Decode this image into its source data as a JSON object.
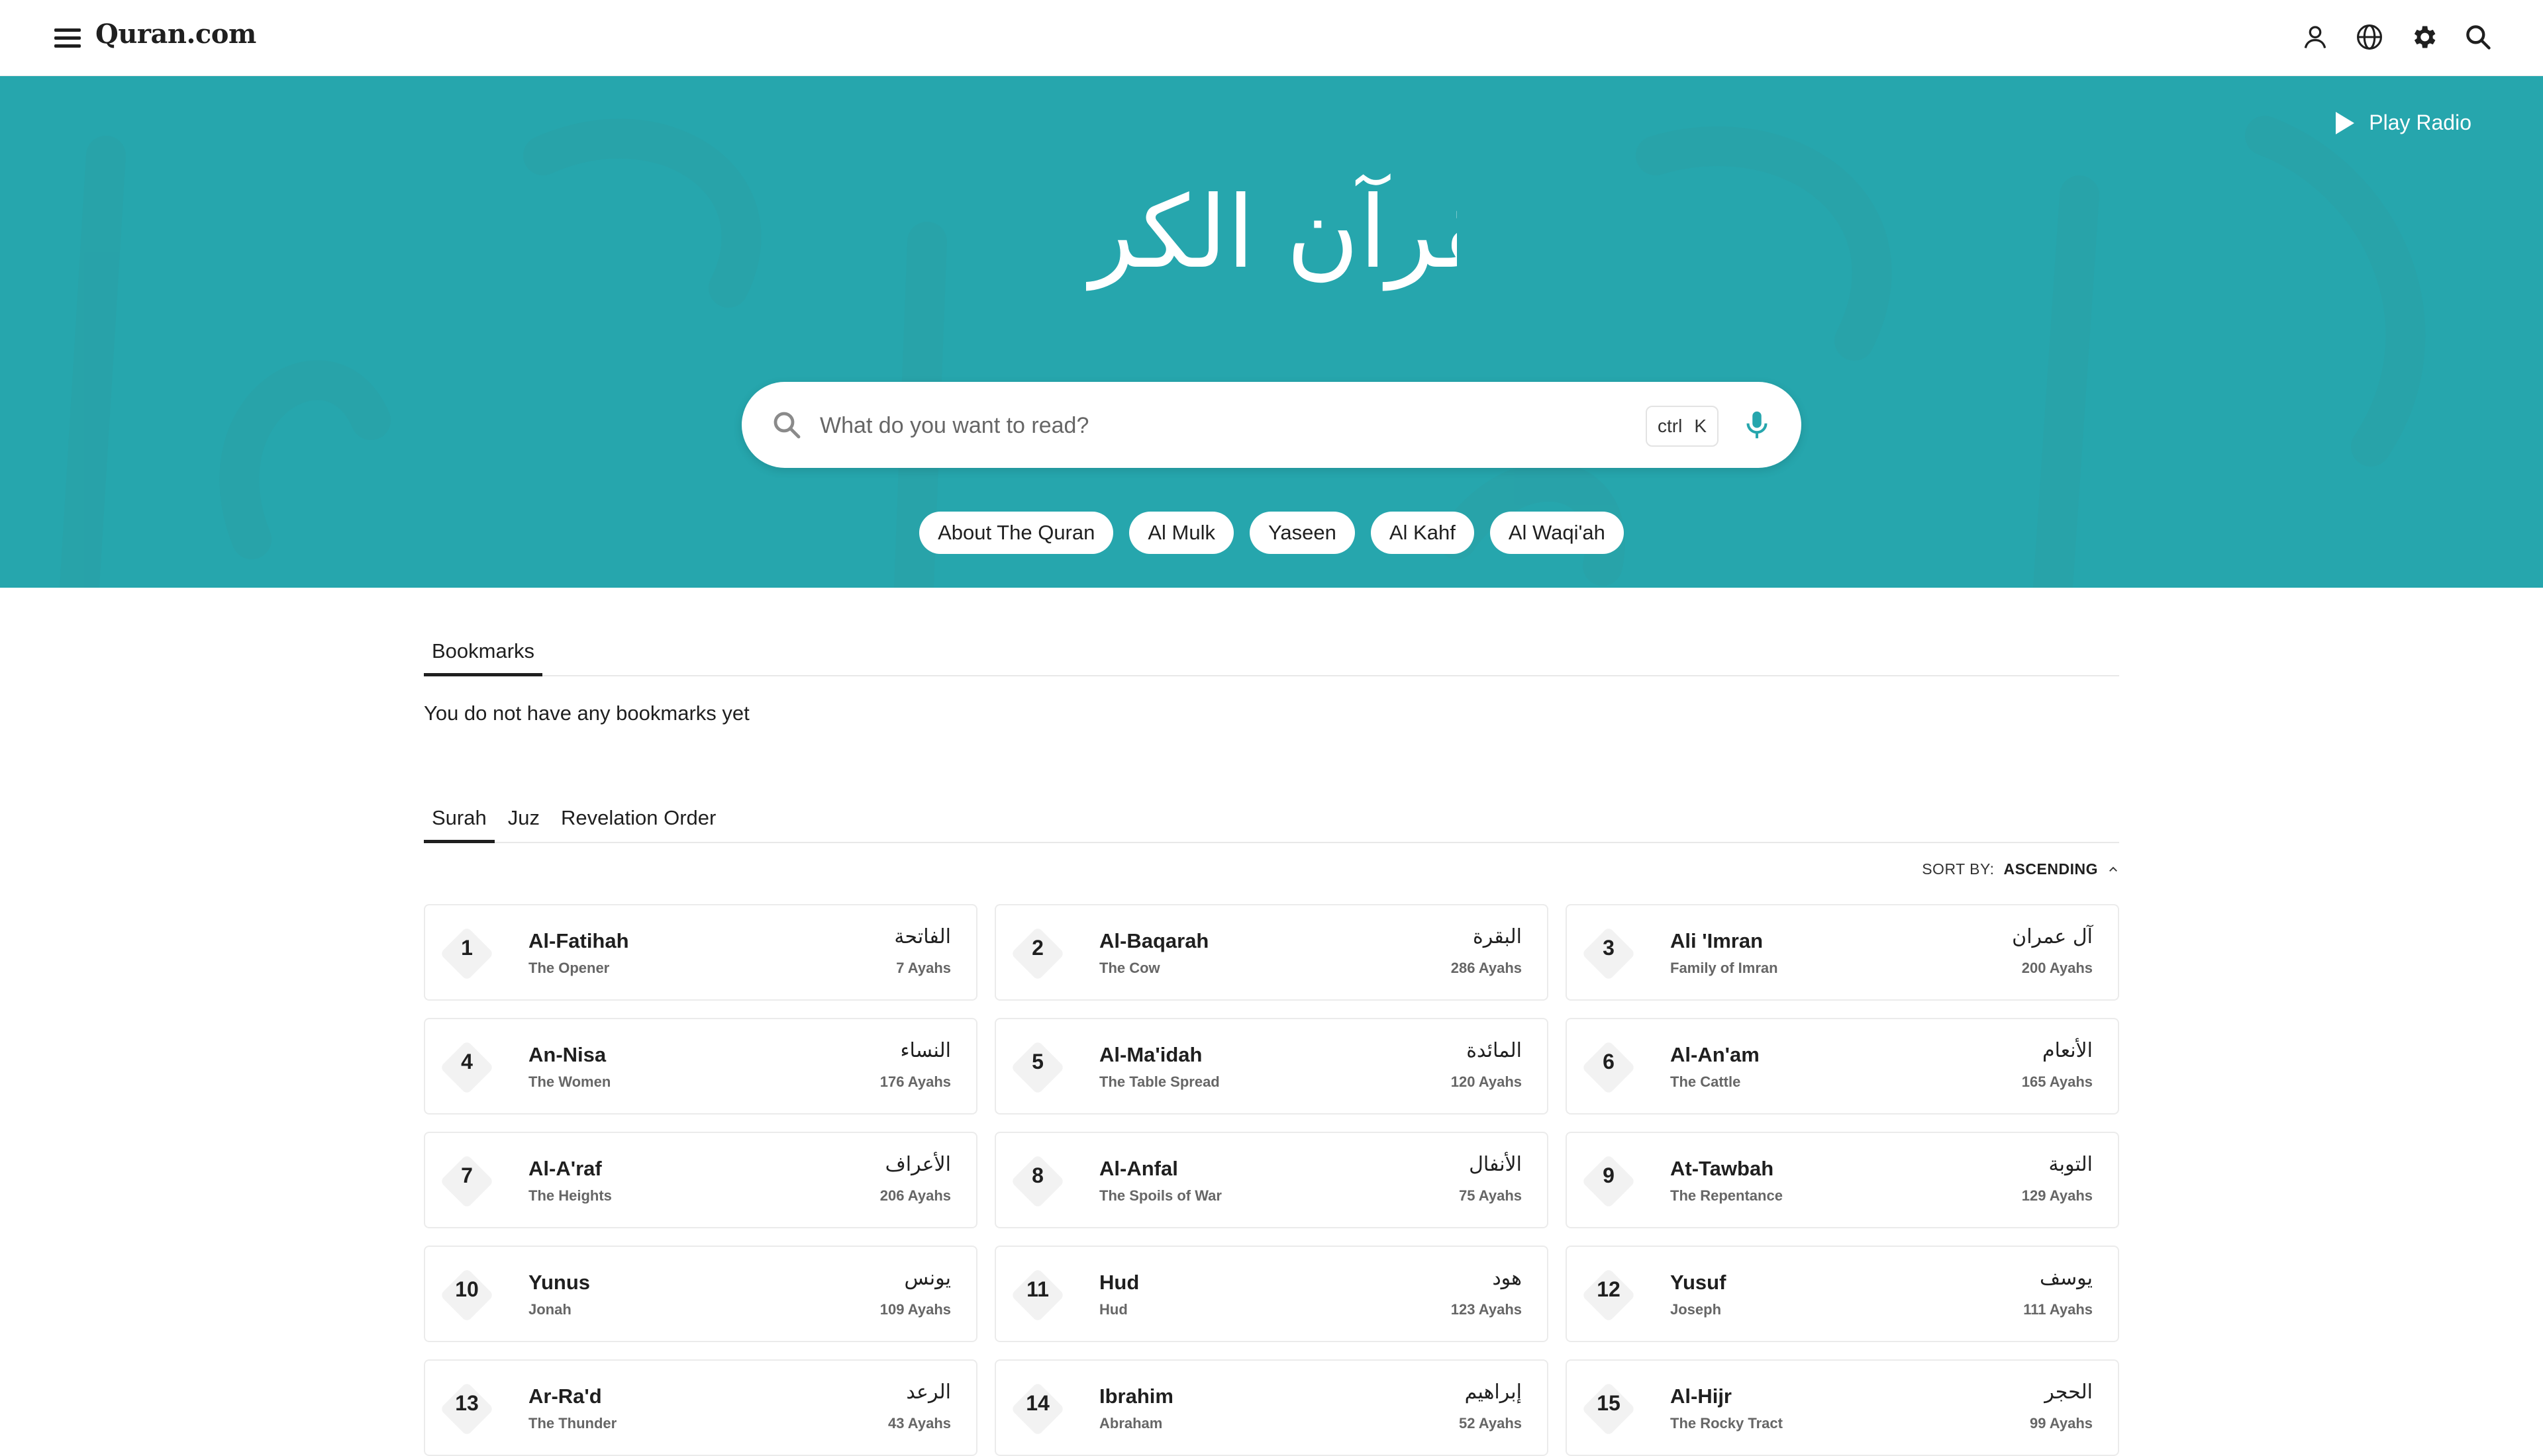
{
  "nav": {
    "logo": "Quran.com",
    "icons": [
      "menu-icon",
      "user-icon",
      "globe-icon",
      "gear-icon",
      "search-icon"
    ]
  },
  "hero": {
    "background_color": "#26a6ad",
    "play_radio_label": "Play Radio",
    "calligraphy": "القرآن الكريم",
    "search_placeholder": "What do you want to read?",
    "shortcut_ctrl": "ctrl",
    "shortcut_key": "K",
    "chips": [
      "About The Quran",
      "Al Mulk",
      "Yaseen",
      "Al Kahf",
      "Al Waqi'ah"
    ]
  },
  "bookmarks": {
    "tab_label": "Bookmarks",
    "empty_message": "You do not have any bookmarks yet"
  },
  "surah_tabs": [
    "Surah",
    "Juz",
    "Revelation Order"
  ],
  "sort": {
    "label": "SORT BY:",
    "value": "ASCENDING"
  },
  "surahs": [
    {
      "num": "1",
      "name": "Al-Fatihah",
      "translation": "The Opener",
      "arabic": "الفاتحة",
      "ayahs": "7 Ayahs"
    },
    {
      "num": "2",
      "name": "Al-Baqarah",
      "translation": "The Cow",
      "arabic": "البقرة",
      "ayahs": "286 Ayahs"
    },
    {
      "num": "3",
      "name": "Ali 'Imran",
      "translation": "Family of Imran",
      "arabic": "آل عمران",
      "ayahs": "200 Ayahs"
    },
    {
      "num": "4",
      "name": "An-Nisa",
      "translation": "The Women",
      "arabic": "النساء",
      "ayahs": "176 Ayahs"
    },
    {
      "num": "5",
      "name": "Al-Ma'idah",
      "translation": "The Table Spread",
      "arabic": "المائدة",
      "ayahs": "120 Ayahs"
    },
    {
      "num": "6",
      "name": "Al-An'am",
      "translation": "The Cattle",
      "arabic": "الأنعام",
      "ayahs": "165 Ayahs"
    },
    {
      "num": "7",
      "name": "Al-A'raf",
      "translation": "The Heights",
      "arabic": "الأعراف",
      "ayahs": "206 Ayahs"
    },
    {
      "num": "8",
      "name": "Al-Anfal",
      "translation": "The Spoils of War",
      "arabic": "الأنفال",
      "ayahs": "75 Ayahs"
    },
    {
      "num": "9",
      "name": "At-Tawbah",
      "translation": "The Repentance",
      "arabic": "التوبة",
      "ayahs": "129 Ayahs"
    },
    {
      "num": "10",
      "name": "Yunus",
      "translation": "Jonah",
      "arabic": "يونس",
      "ayahs": "109 Ayahs"
    },
    {
      "num": "11",
      "name": "Hud",
      "translation": "Hud",
      "arabic": "هود",
      "ayahs": "123 Ayahs"
    },
    {
      "num": "12",
      "name": "Yusuf",
      "translation": "Joseph",
      "arabic": "يوسف",
      "ayahs": "111 Ayahs"
    },
    {
      "num": "13",
      "name": "Ar-Ra'd",
      "translation": "The Thunder",
      "arabic": "الرعد",
      "ayahs": "43 Ayahs"
    },
    {
      "num": "14",
      "name": "Ibrahim",
      "translation": "Abraham",
      "arabic": "إبراهيم",
      "ayahs": "52 Ayahs"
    },
    {
      "num": "15",
      "name": "Al-Hijr",
      "translation": "The Rocky Tract",
      "arabic": "الحجر",
      "ayahs": "99 Ayahs"
    }
  ]
}
